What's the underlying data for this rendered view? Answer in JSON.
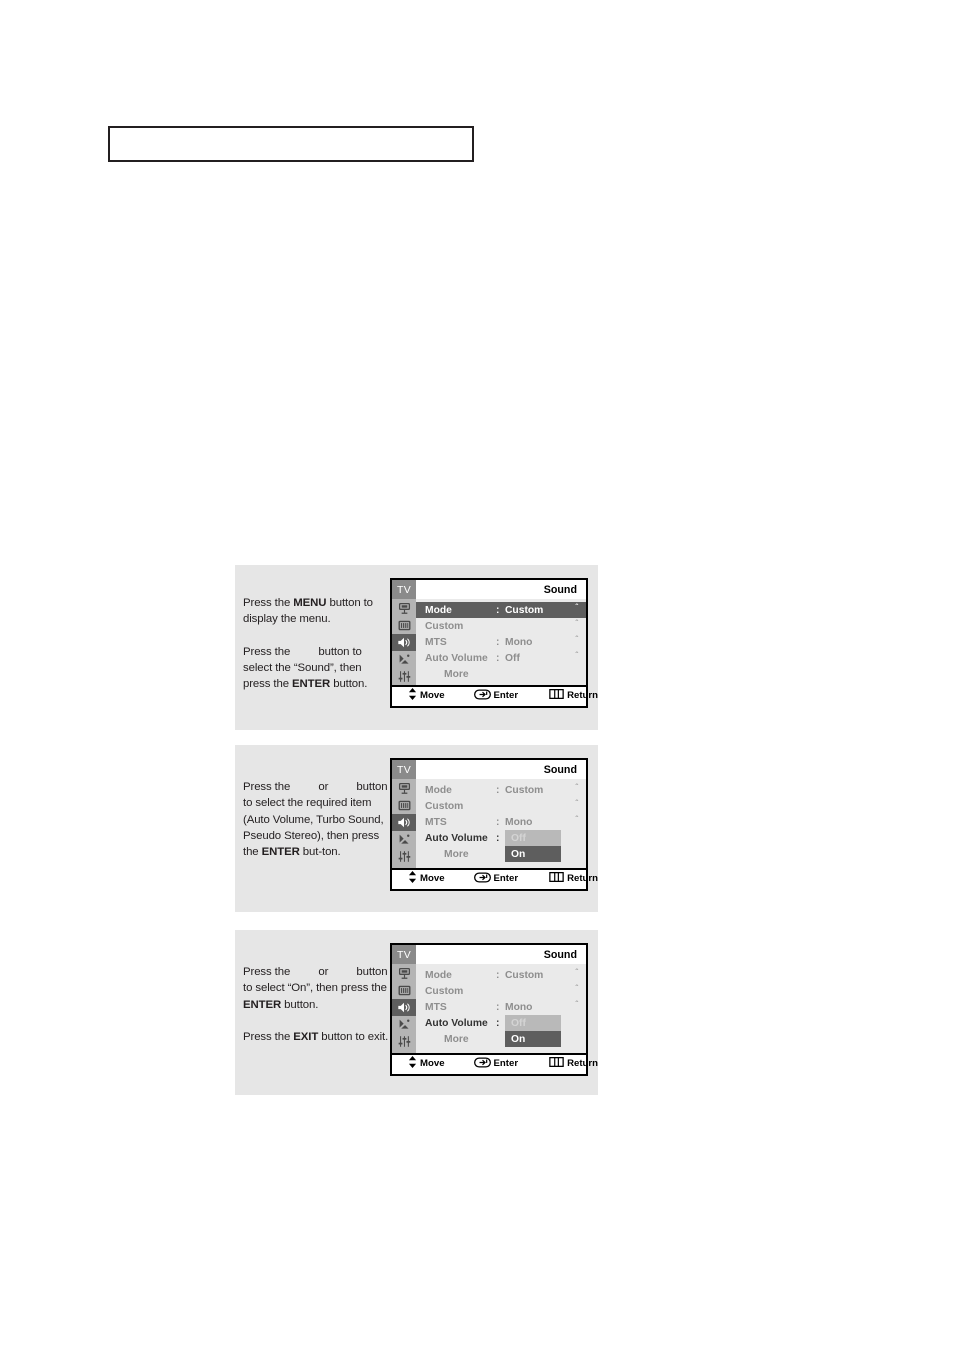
{
  "top_box": {
    "content": ""
  },
  "panels": [
    {
      "id": "panel-1",
      "instructions": [
        {
          "parts": [
            {
              "t": "text",
              "v": "Press the "
            },
            {
              "t": "bold",
              "v": "MENU"
            },
            {
              "t": "text",
              "v": " button to display the menu."
            }
          ]
        },
        {
          "parts": [
            {
              "t": "text",
              "v": "Press the "
            },
            {
              "t": "keygap",
              "v": ""
            },
            {
              "t": "text",
              "v": " button to select the “Sound”, then press the "
            },
            {
              "t": "bold",
              "v": "ENTER"
            },
            {
              "t": "text",
              "v": " button."
            }
          ]
        }
      ],
      "osd": {
        "tv_label": "TV",
        "title": "Sound",
        "rail_icons": [
          "antenna-icon",
          "picture-icon",
          "speaker-icon",
          "satellite-dish-icon",
          "setup-sliders-icon"
        ],
        "rail_active_index": 2,
        "rows": [
          {
            "label": "Mode",
            "colon": ":",
            "value": "Custom",
            "caret": "ˆ",
            "state": "selected"
          },
          {
            "label": "Custom",
            "colon": "",
            "value": "",
            "caret": "ˆ",
            "state": "normal"
          },
          {
            "label": "MTS",
            "colon": ":",
            "value": "Mono",
            "caret": "ˆ",
            "state": "normal"
          },
          {
            "label": "Auto Volume",
            "colon": ":",
            "value": "Off",
            "caret": "ˆ",
            "state": "normal"
          },
          {
            "label": "More",
            "colon": "",
            "value": "",
            "caret": "",
            "state": "indent"
          }
        ],
        "footer": {
          "move": "Move",
          "enter": "Enter",
          "return": "Return"
        }
      }
    },
    {
      "id": "panel-2",
      "instructions": [
        {
          "parts": [
            {
              "t": "text",
              "v": "Press the "
            },
            {
              "t": "keygap",
              "v": ""
            },
            {
              "t": "text",
              "v": " or "
            },
            {
              "t": "keygap",
              "v": ""
            },
            {
              "t": "text",
              "v": " button to select the required item (Auto Volume, Turbo Sound, Pseudo Stereo), then press the "
            },
            {
              "t": "bold",
              "v": "ENTER"
            },
            {
              "t": "text",
              "v": " but-ton."
            }
          ]
        }
      ],
      "osd": {
        "tv_label": "TV",
        "title": "Sound",
        "rail_icons": [
          "antenna-icon",
          "picture-icon",
          "speaker-icon",
          "satellite-dish-icon",
          "setup-sliders-icon"
        ],
        "rail_active_index": 2,
        "rows": [
          {
            "label": "Mode",
            "colon": ":",
            "value": "Custom",
            "caret": "ˆ",
            "state": "normal"
          },
          {
            "label": "Custom",
            "colon": "",
            "value": "",
            "caret": "ˆ",
            "state": "normal"
          },
          {
            "label": "MTS",
            "colon": ":",
            "value": "Mono",
            "caret": "ˆ",
            "state": "normal"
          },
          {
            "label": "Auto Volume",
            "colon": ":",
            "value": "",
            "caret": "",
            "state": "dropdown",
            "options": {
              "off": "Off",
              "on": "On"
            },
            "highlighted": "On"
          },
          {
            "label": "More",
            "colon": "",
            "value": "",
            "caret": "",
            "state": "indent"
          }
        ],
        "footer": {
          "move": "Move",
          "enter": "Enter",
          "return": "Return"
        }
      }
    },
    {
      "id": "panel-3",
      "instructions": [
        {
          "parts": [
            {
              "t": "text",
              "v": "Press the "
            },
            {
              "t": "keygap",
              "v": ""
            },
            {
              "t": "text",
              "v": " or "
            },
            {
              "t": "keygap",
              "v": ""
            },
            {
              "t": "text",
              "v": " button to select “On”, then press the "
            },
            {
              "t": "bold",
              "v": "ENTER"
            },
            {
              "t": "text",
              "v": " button."
            }
          ]
        },
        {
          "parts": [
            {
              "t": "text",
              "v": "Press the "
            },
            {
              "t": "bold",
              "v": "EXIT"
            },
            {
              "t": "text",
              "v": " button to exit."
            }
          ]
        }
      ],
      "osd": {
        "tv_label": "TV",
        "title": "Sound",
        "rail_icons": [
          "antenna-icon",
          "picture-icon",
          "speaker-icon",
          "satellite-dish-icon",
          "setup-sliders-icon"
        ],
        "rail_active_index": 2,
        "rows": [
          {
            "label": "Mode",
            "colon": ":",
            "value": "Custom",
            "caret": "ˆ",
            "state": "normal"
          },
          {
            "label": "Custom",
            "colon": "",
            "value": "",
            "caret": "ˆ",
            "state": "normal"
          },
          {
            "label": "MTS",
            "colon": ":",
            "value": "Mono",
            "caret": "ˆ",
            "state": "normal"
          },
          {
            "label": "Auto Volume",
            "colon": ":",
            "value": "",
            "caret": "",
            "state": "dropdown",
            "options": {
              "off": "Off",
              "on": "On"
            },
            "highlighted": "On"
          },
          {
            "label": "More",
            "colon": "",
            "value": "",
            "caret": "",
            "state": "indent"
          }
        ],
        "footer": {
          "move": "Move",
          "enter": "Enter",
          "return": "Return"
        }
      }
    }
  ],
  "colors": {
    "panel_bg": "#e6e6e6",
    "osd_body_bg": "#eaeaea",
    "osd_rail_bg": "#b4b4b4",
    "highlight": "#5e5e5e",
    "dim_text": "#8e8e8e",
    "option_off_bg": "#b9b9b9",
    "border": "#000000"
  }
}
